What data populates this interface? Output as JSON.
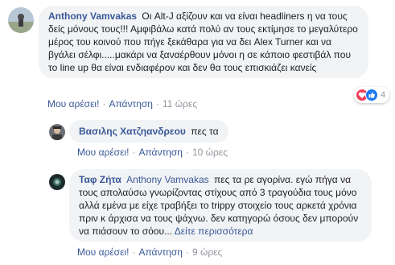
{
  "comments": [
    {
      "author": "Anthony Vamvakas",
      "text": "Οι Alt-J αξίζουν και να είναι headliners η να τους δείς μόνους τους!!! Αμφιβάλω κατά πολύ αν τους εκτίμησε το μεγαλύτερο μέρος του κοινού που πήγε ξεκάθαρα για να δει Alex Turner και να βγάλει σέλφι.....μακάρι να ξαναέρθουν μόνοι η σε κάποιο φεστιβάλ που το line up θα είναι ενδιαφέρον και δεν θα τους επισκιάζει κανείς",
      "like_label": "Μου αρέσει!",
      "reply_label": "Απάντηση",
      "time": "11 ώρες",
      "reactions": {
        "count": "4",
        "colors": {
          "heart": "#f33e58",
          "like": "#1877f2"
        }
      }
    },
    {
      "author": "Βασιλης Χατζηανδρεου",
      "text": "πες τα",
      "like_label": "Μου αρέσει!",
      "reply_label": "Απάντηση",
      "time": "10 ώρες"
    },
    {
      "author": "Ταφ Ζήτα",
      "mention": "Anthony Vamvakas",
      "text": "πες τα ρε αγορίνα. εγώ πήγα να τους απολαύσω γνωρίζοντας στίχους από 3 τραγούδια τους μόνο αλλά εμένα με είχε τραβήξει το trippy στοιχείο τους αρκετά χρόνια πριν κ άρχισα να τους ψάχνω. δεν κατηγορώ όσους δεν μπορούν να πιάσουν το σόου...",
      "see_more": "Δείτε περισσότερα",
      "like_label": "Μου αρέσει!",
      "reply_label": "Απάντηση",
      "time": "9 ώρες"
    }
  ],
  "icons": [
    "avatar",
    "heart-reaction-icon",
    "like-reaction-icon"
  ],
  "colors": {
    "link": "#385898",
    "bubble": "#f2f3f5",
    "meta": "#90949c"
  }
}
